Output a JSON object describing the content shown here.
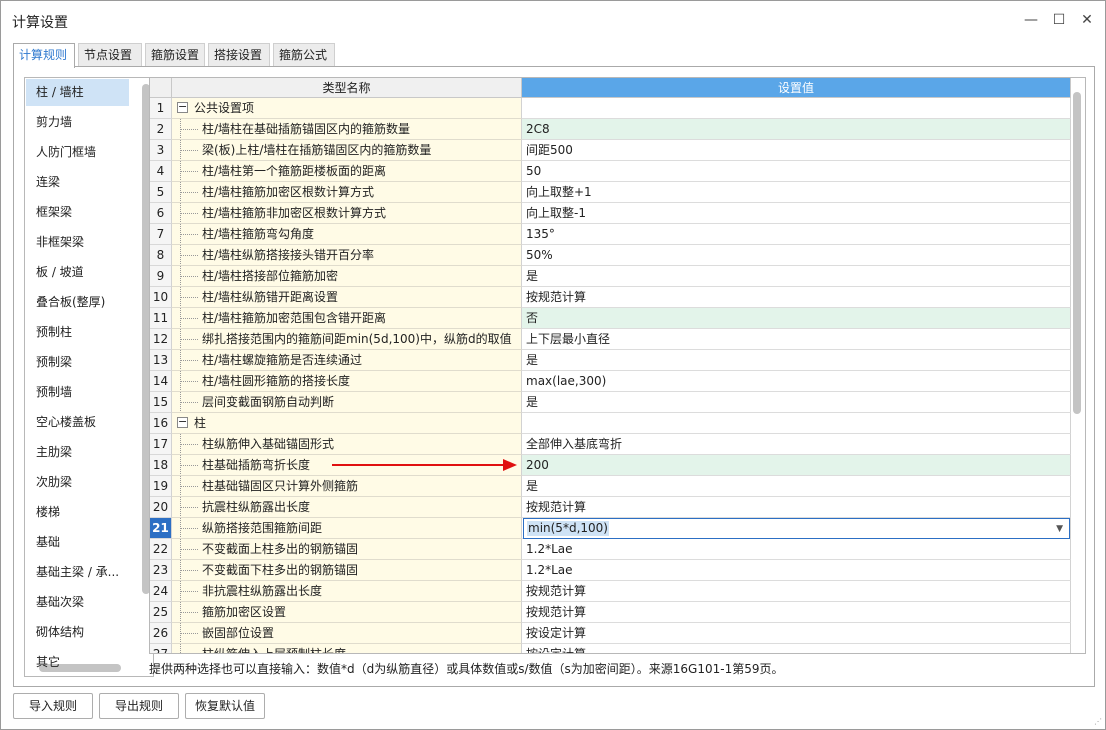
{
  "window": {
    "title": "计算设置"
  },
  "tabs": [
    {
      "label": "计算规则",
      "active": true
    },
    {
      "label": "节点设置",
      "active": false
    },
    {
      "label": "箍筋设置",
      "active": false
    },
    {
      "label": "搭接设置",
      "active": false
    },
    {
      "label": "箍筋公式",
      "active": false
    }
  ],
  "sidebar": {
    "items": [
      "柱 / 墙柱",
      "剪力墙",
      "人防门框墙",
      "连梁",
      "框架梁",
      "非框架梁",
      "板 / 坡道",
      "叠合板(整厚)",
      "预制柱",
      "预制梁",
      "预制墙",
      "空心楼盖板",
      "主肋梁",
      "次肋梁",
      "楼梯",
      "基础",
      "基础主梁 / 承...",
      "基础次梁",
      "砌体结构",
      "其它"
    ],
    "selected_index": 0
  },
  "grid": {
    "columns": [
      "类型名称",
      "设置值"
    ],
    "selected_row": "21",
    "rows": [
      {
        "num": "1",
        "name": "公共设置项",
        "value": "",
        "group": true
      },
      {
        "num": "2",
        "name": "柱/墙柱在基础插筋锚固区内的箍筋数量",
        "value": "2C8",
        "green": true
      },
      {
        "num": "3",
        "name": "梁(板)上柱/墙柱在插筋锚固区内的箍筋数量",
        "value": "间距500"
      },
      {
        "num": "4",
        "name": "柱/墙柱第一个箍筋距楼板面的距离",
        "value": "50"
      },
      {
        "num": "5",
        "name": "柱/墙柱箍筋加密区根数计算方式",
        "value": "向上取整+1"
      },
      {
        "num": "6",
        "name": "柱/墙柱箍筋非加密区根数计算方式",
        "value": "向上取整-1"
      },
      {
        "num": "7",
        "name": "柱/墙柱箍筋弯勾角度",
        "value": "135°"
      },
      {
        "num": "8",
        "name": "柱/墙柱纵筋搭接接头错开百分率",
        "value": "50%"
      },
      {
        "num": "9",
        "name": "柱/墙柱搭接部位箍筋加密",
        "value": "是"
      },
      {
        "num": "10",
        "name": "柱/墙柱纵筋错开距离设置",
        "value": "按规范计算"
      },
      {
        "num": "11",
        "name": "柱/墙柱箍筋加密范围包含错开距离",
        "value": "否",
        "green": true
      },
      {
        "num": "12",
        "name": "绑扎搭接范围内的箍筋间距min(5d,100)中，纵筋d的取值",
        "value": "上下层最小直径"
      },
      {
        "num": "13",
        "name": "柱/墙柱螺旋箍筋是否连续通过",
        "value": "是"
      },
      {
        "num": "14",
        "name": "柱/墙柱圆形箍筋的搭接长度",
        "value": "max(lae,300)"
      },
      {
        "num": "15",
        "name": "层间变截面钢筋自动判断",
        "value": "是"
      },
      {
        "num": "16",
        "name": "柱",
        "value": "",
        "group": true
      },
      {
        "num": "17",
        "name": "柱纵筋伸入基础锚固形式",
        "value": "全部伸入基底弯折"
      },
      {
        "num": "18",
        "name": "柱基础插筋弯折长度",
        "value": "200",
        "green": true
      },
      {
        "num": "19",
        "name": "柱基础锚固区只计算外侧箍筋",
        "value": "是"
      },
      {
        "num": "20",
        "name": "抗震柱纵筋露出长度",
        "value": "按规范计算"
      },
      {
        "num": "21",
        "name": "纵筋搭接范围箍筋间距",
        "value": "min(5*d,100)",
        "editing": true
      },
      {
        "num": "22",
        "name": "不变截面上柱多出的钢筋锚固",
        "value": "1.2*Lae"
      },
      {
        "num": "23",
        "name": "不变截面下柱多出的钢筋锚固",
        "value": "1.2*Lae"
      },
      {
        "num": "24",
        "name": "非抗震柱纵筋露出长度",
        "value": "按规范计算"
      },
      {
        "num": "25",
        "name": "箍筋加密区设置",
        "value": "按规范计算"
      },
      {
        "num": "26",
        "name": "嵌固部位设置",
        "value": "按设定计算"
      },
      {
        "num": "27",
        "name": "柱纵筋伸入上层预制柱长度",
        "value": "按设定计算"
      }
    ]
  },
  "hint": "提供两种选择也可以直接输入：数值*d（d为纵筋直径）或具体数值或s/数值（s为加密间距）。来源16G101-1第59页。",
  "buttons": {
    "import": "导入规则",
    "export": "导出规则",
    "restore": "恢复默认值"
  },
  "icons": {
    "minimize": "minimize-icon",
    "maximize": "maximize-icon",
    "close": "close-icon",
    "dropdown": "chevron-down-icon",
    "collapse": "minus-box-icon"
  },
  "colors": {
    "selected": "#2c6fc4",
    "header_accent": "#5aa6e8",
    "highlight_green": "#e3f4ea",
    "name_column": "#fffbe6",
    "annotation_arrow": "#e01010"
  }
}
